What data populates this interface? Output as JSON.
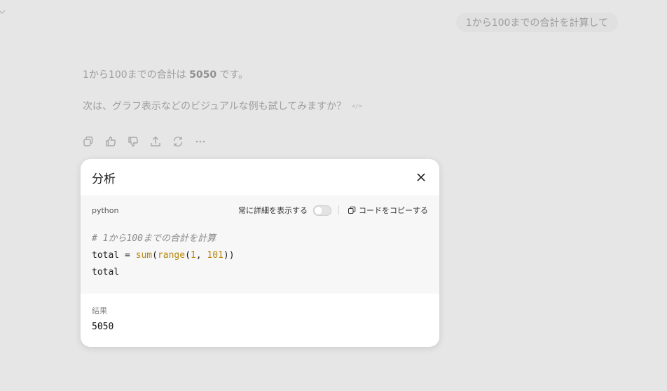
{
  "user_message": "1から100までの合計を計算して",
  "assistant": {
    "line1_prefix": "1から100までの合計は ",
    "line1_bold": "5050",
    "line1_suffix": " です。",
    "line2": "次は、グラフ表示などのビジュアルな例も試してみますか？",
    "code_marker": "</>"
  },
  "actions": [
    {
      "name": "copy-icon"
    },
    {
      "name": "thumbs-up-icon"
    },
    {
      "name": "thumbs-down-icon"
    },
    {
      "name": "share-icon"
    },
    {
      "name": "regenerate-icon"
    },
    {
      "name": "more-icon"
    }
  ],
  "panel": {
    "title": "分析",
    "language": "python",
    "show_details_label": "常に詳細を表示する",
    "show_details_enabled": false,
    "copy_code_label": "コードをコピーする",
    "code": {
      "comment": "# 1から100までの合計を計算",
      "line2_var": "total = ",
      "line2_fn1": "sum",
      "line2_p1": "(",
      "line2_fn2": "range",
      "line2_p2": "(",
      "line2_n1": "1",
      "line2_sep": ", ",
      "line2_n2": "101",
      "line2_end": "))",
      "line3": "total"
    },
    "result_label": "結果",
    "result_value": "5050"
  }
}
